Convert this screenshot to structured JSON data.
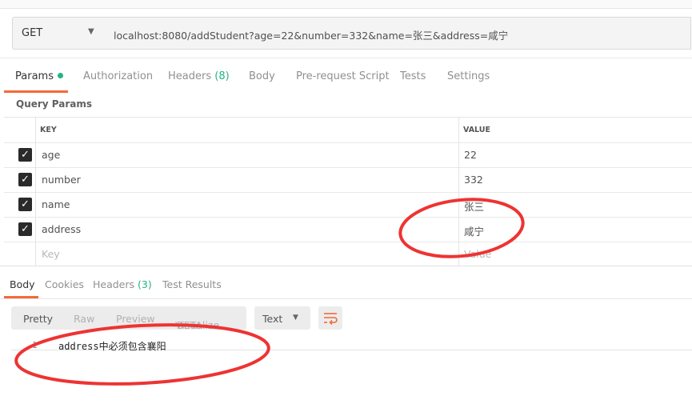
{
  "request": {
    "method": "GET",
    "url": "localhost:8080/addStudent?age=22&number=332&name=张三&address=咸宁"
  },
  "request_tabs": {
    "params": "Params",
    "authorization": "Authorization",
    "headers": "Headers",
    "headers_count": "(8)",
    "body": "Body",
    "prerequest": "Pre-request Script",
    "tests": "Tests",
    "settings": "Settings"
  },
  "query_params": {
    "title": "Query Params",
    "key_header": "KEY",
    "value_header": "VALUE",
    "rows": [
      {
        "key": "age",
        "value": "22"
      },
      {
        "key": "number",
        "value": "332"
      },
      {
        "key": "name",
        "value": "张三"
      },
      {
        "key": "address",
        "value": "咸宁"
      }
    ],
    "key_placeholder": "Key",
    "value_placeholder": "Value"
  },
  "response_tabs": {
    "body": "Body",
    "cookies": "Cookies",
    "headers": "Headers",
    "headers_count": "(3)",
    "test_results": "Test Results"
  },
  "response_view": {
    "pretty": "Pretty",
    "raw": "Raw",
    "preview": "Preview",
    "visualize": "Visualize",
    "beta": "BETA",
    "format": "Text"
  },
  "response_body": {
    "line_number": "1",
    "text": "address中必须包含襄阳"
  },
  "colors": {
    "accent": "#f26b3a",
    "count_green": "#26b47f",
    "annotation_red": "#ee3333"
  },
  "icons": {
    "checkbox": "check-icon",
    "dropdown": "chevron-down-icon",
    "wrap": "wrap-lines-icon"
  }
}
